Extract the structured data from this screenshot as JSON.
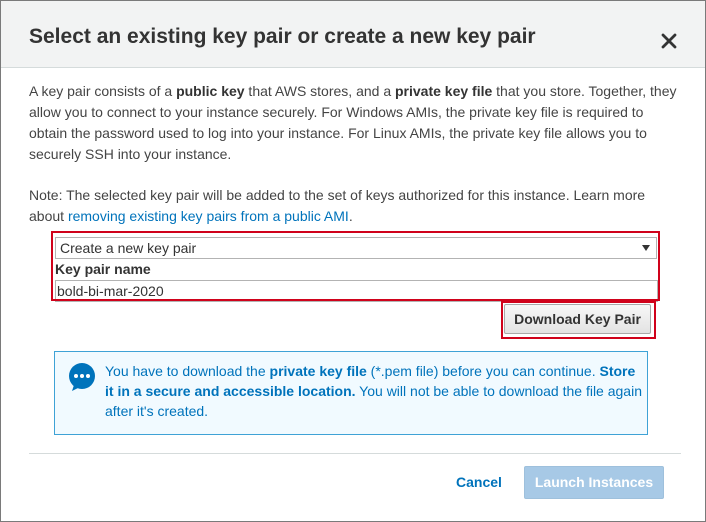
{
  "dialog": {
    "title": "Select an existing key pair or create a new key pair",
    "close_label": "×"
  },
  "description": {
    "p1_a": "A key pair consists of a ",
    "p1_b": "public key",
    "p1_c": " that AWS stores, and a ",
    "p1_d": "private key file",
    "p1_e": " that you store. Together, they allow you to connect to your instance securely. For Windows AMIs, the private key file is required to obtain the password used to log into your instance. For Linux AMIs, the private key file allows you to securely SSH into your instance.",
    "p2_a": "Note: The selected key pair will be added to the set of keys authorized for this instance. Learn more about ",
    "p2_link": "removing existing key pairs from a public AMI",
    "p2_b": "."
  },
  "key_pair": {
    "select_value": "Create a new key pair",
    "name_label": "Key pair name",
    "name_value": "bold-bi-mar-2020",
    "download_label": "Download Key Pair"
  },
  "alert": {
    "t1": "You have to download the ",
    "t2": "private key file",
    "t3": " (*.pem file) before you can continue. ",
    "t4": "Store it in a secure and accessible location.",
    "t5": " You will not be able to download the file again after it's created."
  },
  "footer": {
    "cancel_label": "Cancel",
    "launch_label": "Launch Instances"
  },
  "colors": {
    "accent": "#0073bb",
    "highlight": "#d0021b",
    "alert_border": "#3ea2d6",
    "launch_disabled": "#a7c9e6"
  }
}
